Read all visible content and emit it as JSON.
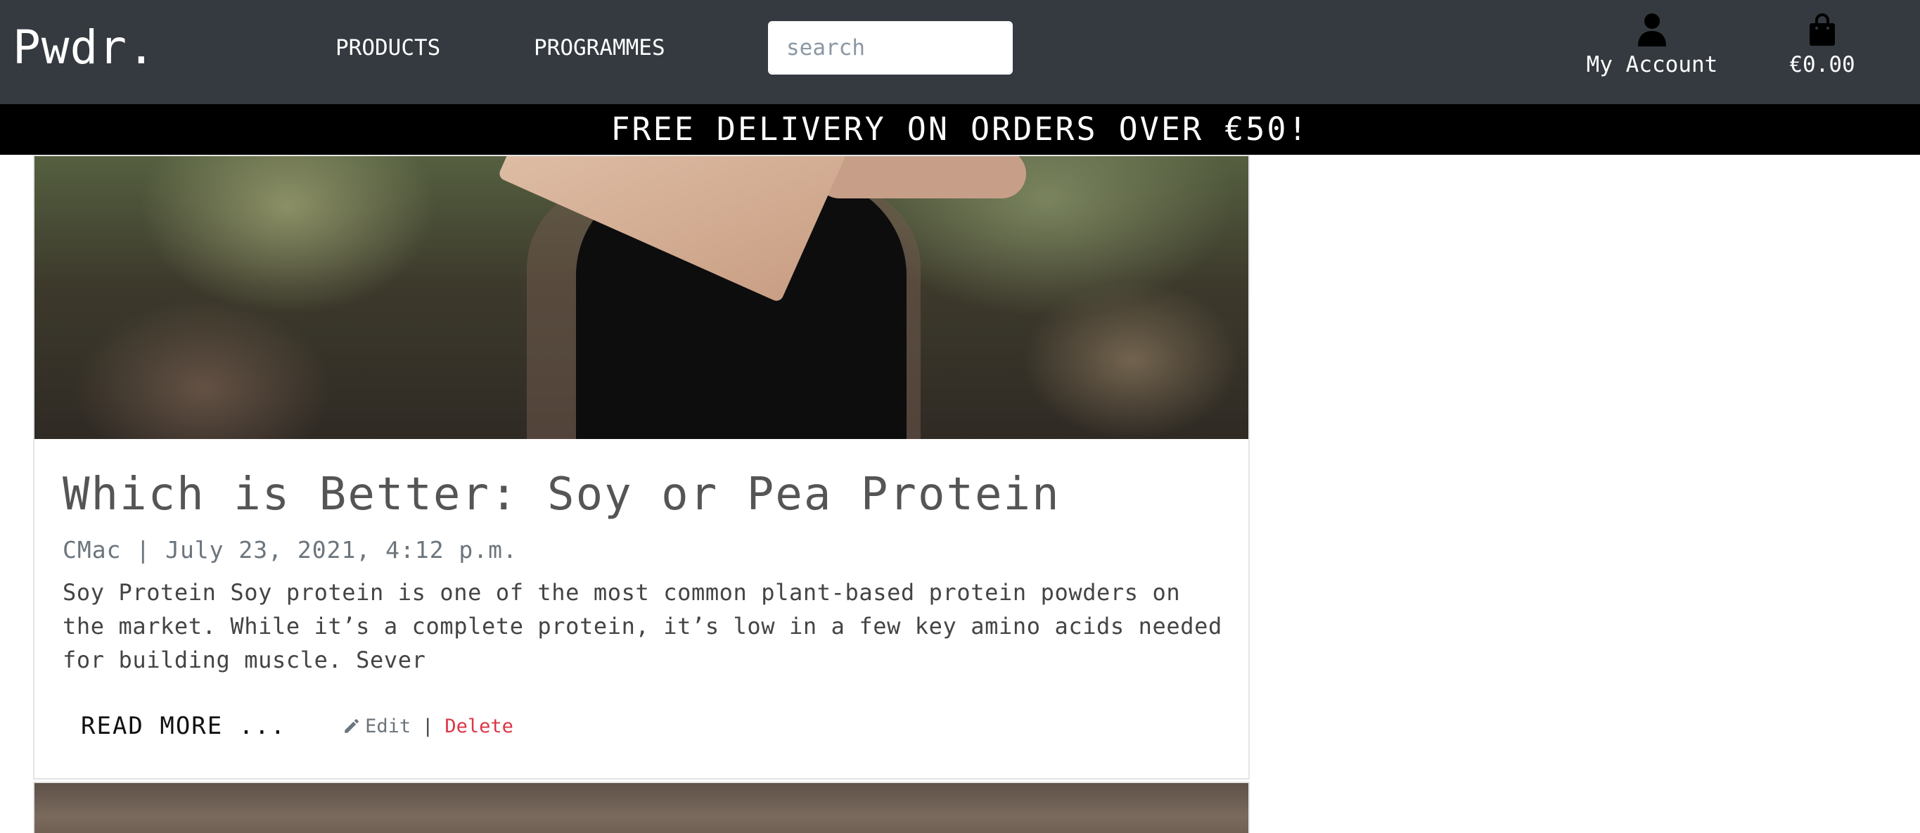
{
  "header": {
    "brand": "Pwdr.",
    "nav": [
      {
        "label": "PRODUCTS"
      },
      {
        "label": "PROGRAMMES"
      }
    ],
    "search": {
      "placeholder": "search",
      "button_icon": "search-icon"
    },
    "account": {
      "label": "My Account",
      "icon": "user-icon"
    },
    "bag": {
      "total": "€0.00",
      "icon": "shopping-bag-icon"
    }
  },
  "banner": {
    "text": "FREE DELIVERY ON ORDERS OVER €50!"
  },
  "post": {
    "image_icon": "protein-pouch-photo",
    "title": "Which is Better: Soy or Pea Protein",
    "meta": "CMac | July 23, 2021, 4:12 p.m.",
    "excerpt": "Soy Protein Soy protein is one of the most common plant-based protein powders on the market. While it’s a complete protein, it’s low in a few key amino acids needed for building muscle. Sever",
    "read_more": "READ MORE ...",
    "edit_label": "Edit",
    "separator": "|",
    "delete_label": "Delete"
  },
  "colors": {
    "navbar": "#343a40",
    "banner": "#000000",
    "delete": "#dc3545",
    "muted": "#6c757d"
  }
}
